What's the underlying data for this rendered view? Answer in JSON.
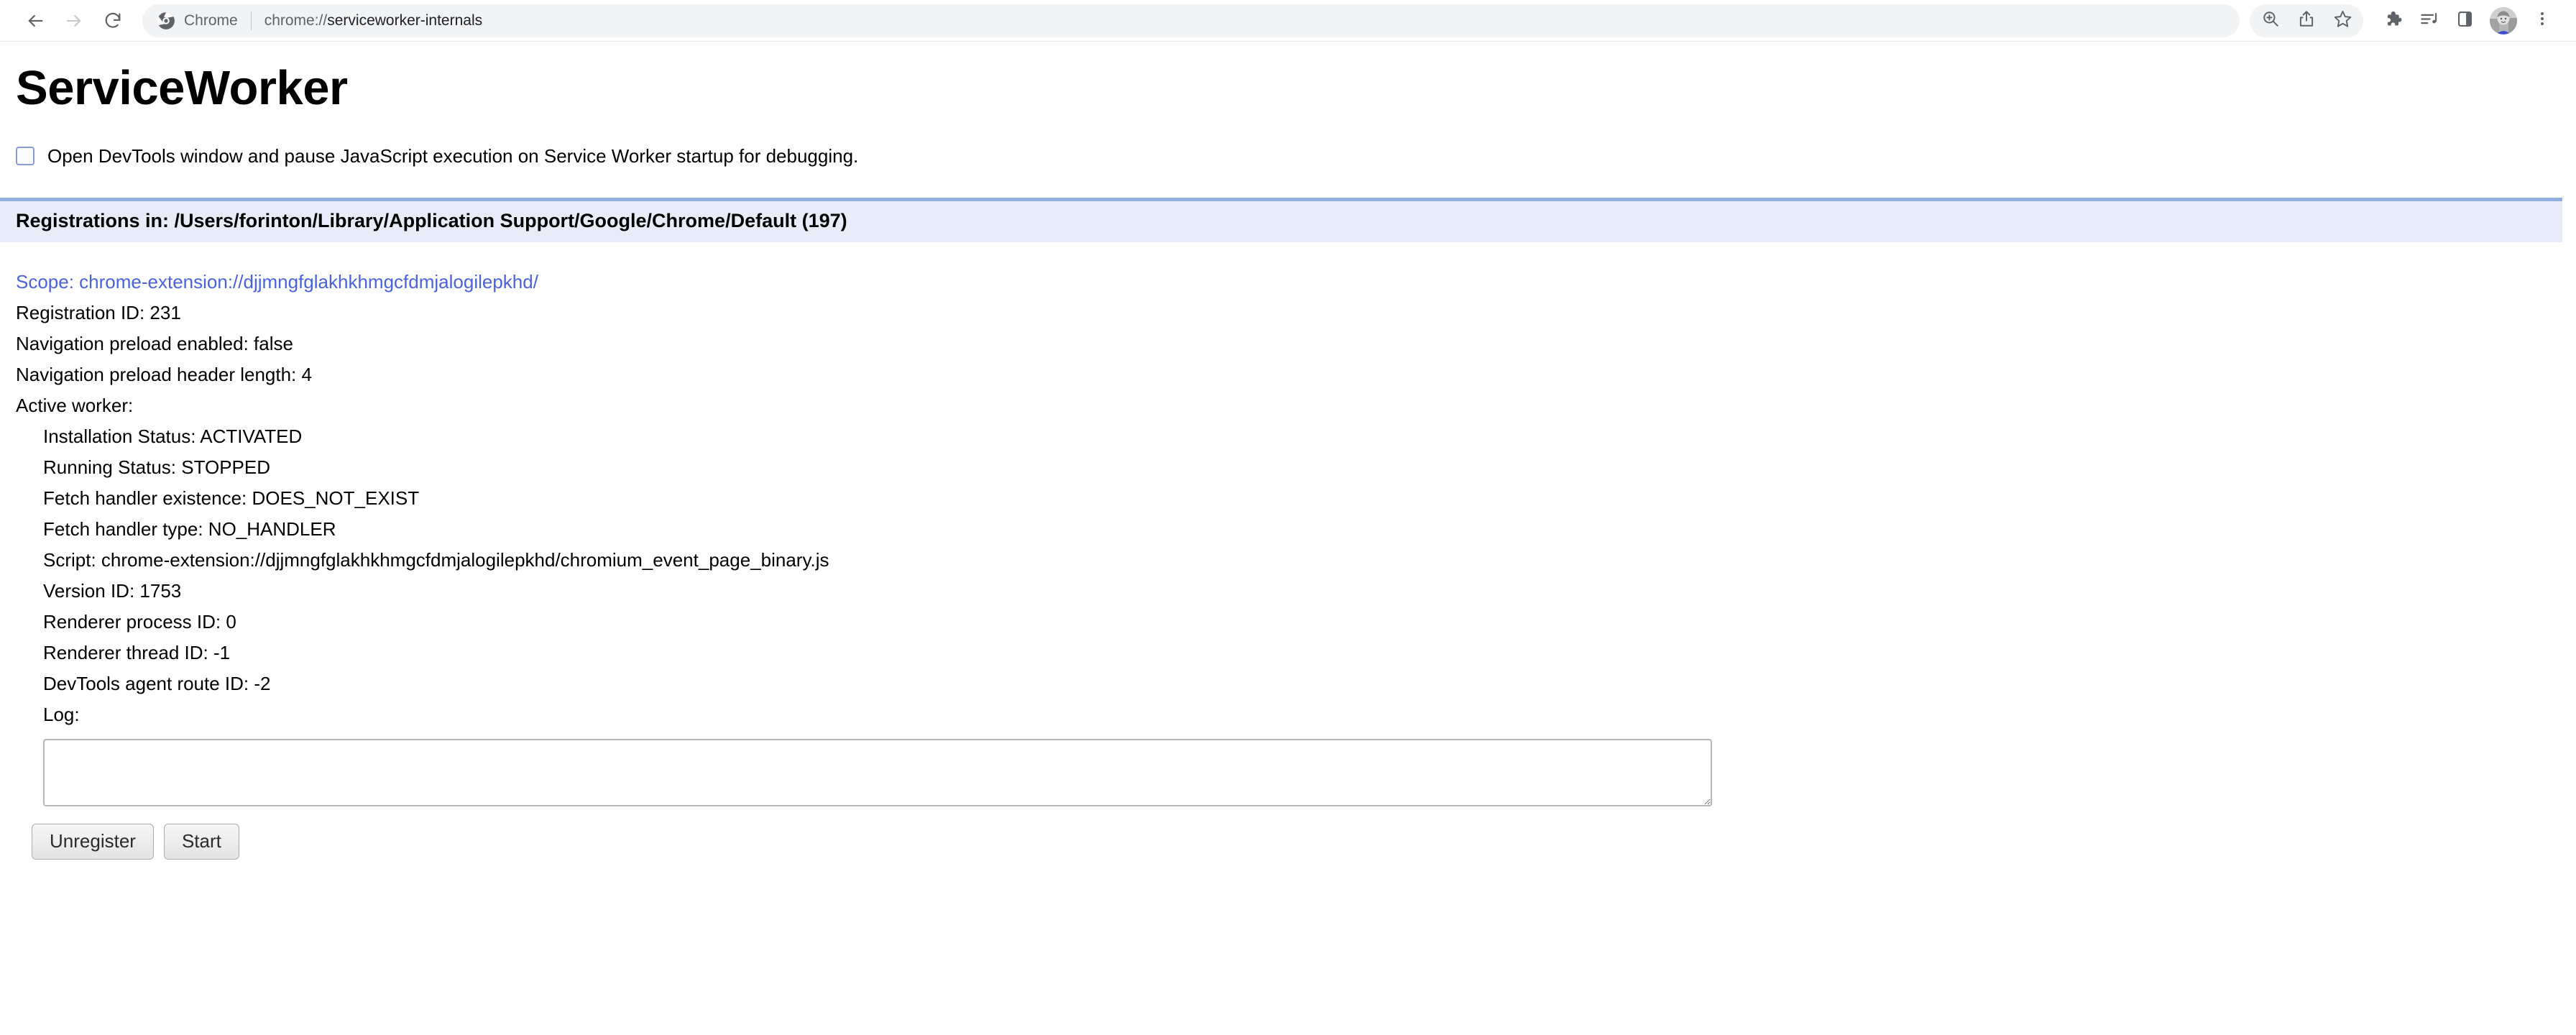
{
  "browser": {
    "nav": {
      "back_icon": "arrow-left-icon",
      "forward_icon": "arrow-right-icon",
      "reload_icon": "reload-icon"
    },
    "omnibox": {
      "brand_icon": "chrome-logo-icon",
      "brand_label": "Chrome",
      "url_prefix": "chrome://",
      "url_main": "serviceworker-internals",
      "url_full": "chrome://serviceworker-internals"
    },
    "toolbar_icons": [
      {
        "name": "zoom-icon",
        "title": "Zoom"
      },
      {
        "name": "share-icon",
        "title": "Share"
      },
      {
        "name": "bookmark-star-icon",
        "title": "Bookmark this tab"
      },
      {
        "name": "extensions-puzzle-icon",
        "title": "Extensions"
      },
      {
        "name": "media-playlist-icon",
        "title": "Media"
      },
      {
        "name": "side-panel-icon",
        "title": "Side panel"
      },
      {
        "name": "avatar",
        "title": "Profile"
      },
      {
        "name": "three-dot-menu-icon",
        "title": "Customize and control Google Chrome"
      }
    ]
  },
  "page": {
    "title": "ServiceWorker",
    "devtools_option": {
      "label": "Open DevTools window and pause JavaScript execution on Service Worker startup for debugging.",
      "checked": false
    },
    "registrations_header": "Registrations in: /Users/forinton/Library/Application Support/Google/Chrome/Default (197)",
    "registration": {
      "scope": "Scope: chrome-extension://djjmngfglakhkhmgcfdmjalogilepkhd/",
      "registration_id": "Registration ID: 231",
      "navigation_preload_enabled": "Navigation preload enabled: false",
      "navigation_preload_header_length": "Navigation preload header length: 4",
      "active_worker_label": "Active worker:",
      "installation_status": "Installation Status: ACTIVATED",
      "running_status": "Running Status: STOPPED",
      "fetch_handler_existence": "Fetch handler existence: DOES_NOT_EXIST",
      "fetch_handler_type": "Fetch handler type: NO_HANDLER",
      "script": "Script: chrome-extension://djjmngfglakhkhmgcfdmjalogilepkhd/chromium_event_page_binary.js",
      "version_id": "Version ID: 1753",
      "renderer_process_id": "Renderer process ID: 0",
      "renderer_thread_id": "Renderer thread ID: -1",
      "devtools_agent_route_id": "DevTools agent route ID: -2",
      "log_label": "Log:",
      "log_value": "",
      "log_placeholder": ""
    },
    "buttons": {
      "unregister": "Unregister",
      "start": "Start"
    }
  },
  "colors": {
    "link": "#4a62e0",
    "header_background": "#e8ecf8",
    "header_top_border": "#8fb0e0",
    "omnibox_background": "#f1f3f4",
    "text": "#000000"
  }
}
